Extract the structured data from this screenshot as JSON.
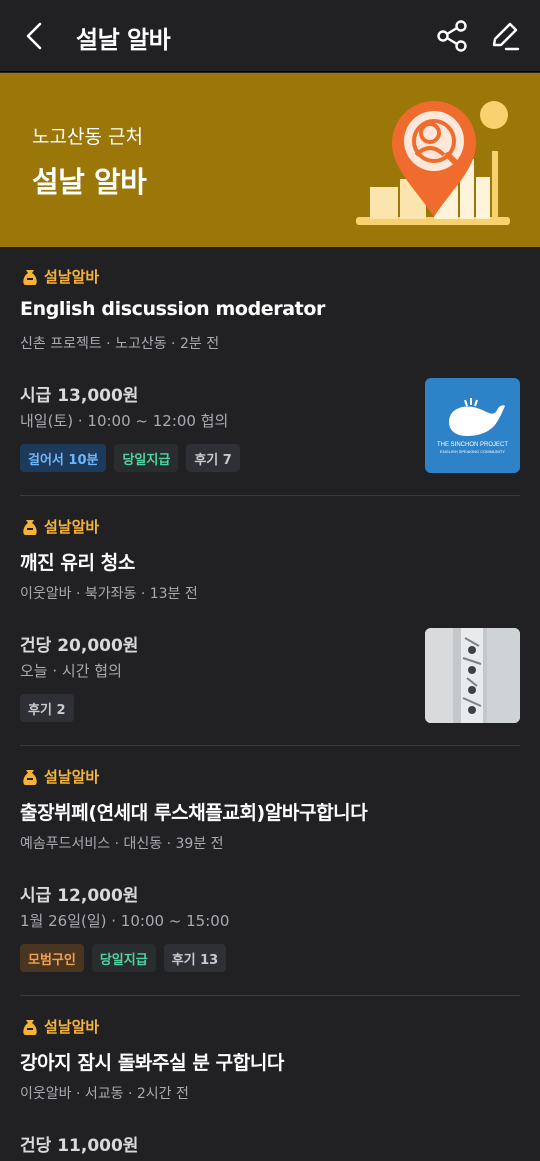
{
  "header": {
    "title": "설날 알바"
  },
  "banner": {
    "subtitle": "노고산동 근처",
    "title": "설날 알바"
  },
  "colors": {
    "banner_bg": "#9A7708",
    "badge": "#F5B33A",
    "bg": "#212124"
  },
  "jobs": [
    {
      "badge": "설날알바",
      "title": "English discussion moderator",
      "meta": "신촌 프로젝트 · 노고산동 · 2분 전",
      "pay": "시급 13,000원",
      "time": "내일(토) · 10:00 ~ 12:00 협의",
      "tags": [
        "걸어서 10분",
        "당일지급",
        "후기 7"
      ],
      "thumb_text": [
        "THE SINCHON PROJECT",
        "ENGLISH SPEAKING COMMUNITY"
      ]
    },
    {
      "badge": "설날알바",
      "title": "깨진 유리 청소",
      "meta": "이웃알바 · 북가좌동 · 13분 전",
      "pay": "건당 20,000원",
      "time": "오늘 · 시간 협의",
      "tags": [
        "후기 2"
      ]
    },
    {
      "badge": "설날알바",
      "title": "출장뷔페(연세대 루스채플교회)알바구합니다",
      "meta": "예솜푸드서비스 · 대신동 · 39분 전",
      "pay": "시급 12,000원",
      "time": "1월 26일(일) · 10:00 ~ 15:00",
      "tags": [
        "모범구인",
        "당일지급",
        "후기 13"
      ]
    },
    {
      "badge": "설날알바",
      "title": "강아지 잠시 돌봐주실 분 구합니다",
      "meta": "이웃알바 · 서교동 · 2시간 전",
      "pay": "건당 11,000원"
    }
  ]
}
